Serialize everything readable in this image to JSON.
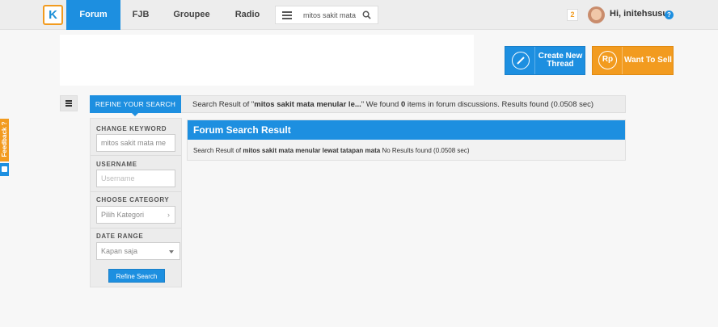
{
  "nav": {
    "logo_letter": "K",
    "tabs": [
      {
        "label": "Forum",
        "active": true
      },
      {
        "label": "FJB",
        "active": false
      },
      {
        "label": "Groupee",
        "active": false
      },
      {
        "label": "Radio",
        "active": false
      }
    ],
    "search_value": "mitos sakit mata",
    "notification_count": "2",
    "greeting": "Hi, initehsusu",
    "help_icon": "?"
  },
  "actions": {
    "create_thread_label": "Create New Thread",
    "create_thread_icon": "pencil-icon",
    "sell_label": "Want To Sell",
    "sell_icon_text": "Rp"
  },
  "refine": {
    "tab_label": "REFINE YOUR SEARCH",
    "result_prefix": "Search Result of \"",
    "result_query": "mitos sakit mata menular le...",
    "result_mid": "\" We found ",
    "result_count": "0",
    "result_suffix": " items in forum discussions. Results found (0.0508 sec)"
  },
  "sidebar": {
    "keyword_label": "CHANGE KEYWORD",
    "keyword_value": "mitos sakit mata me",
    "username_label": "USERNAME",
    "username_placeholder": "Username",
    "category_label": "CHOOSE CATEGORY",
    "category_value": "Pilih Kategori",
    "date_label": "DATE RANGE",
    "date_value": "Kapan saja",
    "refine_button": "Refine Search"
  },
  "results": {
    "heading": "Forum Search Result",
    "body_prefix": "Search Result of ",
    "body_query": "mitos sakit mata menular lewat tatapan mata",
    "body_suffix": " No Results found (0.0508 sec)"
  },
  "feedback": {
    "label": "Feedback ?"
  },
  "colors": {
    "primary_blue": "#1d8fe0",
    "accent_orange": "#f29b1f",
    "background": "#f7f7f7"
  }
}
